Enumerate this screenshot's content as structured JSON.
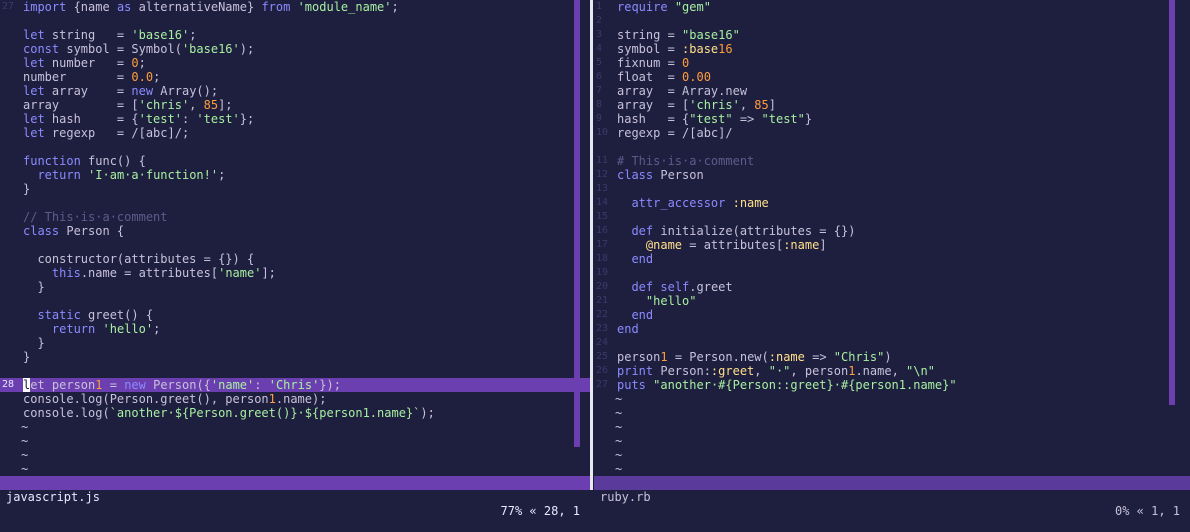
{
  "left": {
    "filename": "javascript.js",
    "position": "77% « 28, 1",
    "lines": [
      {
        "n": "27",
        "code": "import {name as alternativeName} from 'module_name';"
      },
      {
        "n": "",
        "code": ""
      },
      {
        "n": "",
        "code": "let string   = 'base16';"
      },
      {
        "n": "",
        "code": "const symbol = Symbol('base16');"
      },
      {
        "n": "",
        "code": "let number   = 0;"
      },
      {
        "n": "",
        "code": "number       = 0.0;"
      },
      {
        "n": "",
        "code": "let array    = new Array();"
      },
      {
        "n": "",
        "code": "array        = ['chris', 85];"
      },
      {
        "n": "",
        "code": "let hash     = {'test': 'test'};"
      },
      {
        "n": "",
        "code": "let regexp   = /[abc]/;"
      },
      {
        "n": "",
        "code": ""
      },
      {
        "n": "",
        "code": "function func() {"
      },
      {
        "n": "",
        "code": "  return 'I·am·a·function!';"
      },
      {
        "n": "",
        "code": "}"
      },
      {
        "n": "",
        "code": ""
      },
      {
        "n": "",
        "code": "// This·is·a·comment"
      },
      {
        "n": "",
        "code": "class Person {"
      },
      {
        "n": "",
        "code": ""
      },
      {
        "n": "",
        "code": "  constructor(attributes = {}) {"
      },
      {
        "n": "",
        "code": "    this.name = attributes['name'];"
      },
      {
        "n": "",
        "code": "  }"
      },
      {
        "n": "",
        "code": ""
      },
      {
        "n": "",
        "code": "  static greet() {"
      },
      {
        "n": "",
        "code": "    return 'hello';"
      },
      {
        "n": "",
        "code": "  }"
      },
      {
        "n": "",
        "code": "}"
      },
      {
        "n": "",
        "code": ""
      },
      {
        "n": "28",
        "code": "let person1 = new Person({'name': 'Chris'});"
      },
      {
        "n": "",
        "code": "console.log(Person.greet(), person1.name);"
      },
      {
        "n": "",
        "code": "console.log(`another·${Person.greet()}·${person1.name}`);"
      }
    ],
    "tildes": 4
  },
  "right": {
    "filename": "ruby.rb",
    "position": "0% « 1, 1",
    "lines": [
      {
        "n": "1",
        "code": "require \"gem\""
      },
      {
        "n": "2",
        "code": ""
      },
      {
        "n": "3",
        "code": "string = \"base16\""
      },
      {
        "n": "4",
        "code": "symbol = :base16"
      },
      {
        "n": "5",
        "code": "fixnum = 0"
      },
      {
        "n": "6",
        "code": "float  = 0.00"
      },
      {
        "n": "7",
        "code": "array  = Array.new"
      },
      {
        "n": "8",
        "code": "array  = ['chris', 85]"
      },
      {
        "n": "9",
        "code": "hash   = {\"test\" => \"test\"}"
      },
      {
        "n": "10",
        "code": "regexp = /[abc]/"
      },
      {
        "n": "",
        "code": ""
      },
      {
        "n": "11",
        "code": "# This·is·a·comment"
      },
      {
        "n": "12",
        "code": "class Person"
      },
      {
        "n": "13",
        "code": ""
      },
      {
        "n": "14",
        "code": "  attr_accessor :name"
      },
      {
        "n": "15",
        "code": ""
      },
      {
        "n": "16",
        "code": "  def initialize(attributes = {})"
      },
      {
        "n": "17",
        "code": "    @name = attributes[:name]"
      },
      {
        "n": "18",
        "code": "  end"
      },
      {
        "n": "19",
        "code": ""
      },
      {
        "n": "20",
        "code": "  def self.greet"
      },
      {
        "n": "21",
        "code": "    \"hello\""
      },
      {
        "n": "22",
        "code": "  end"
      },
      {
        "n": "23",
        "code": "end"
      },
      {
        "n": "24",
        "code": ""
      },
      {
        "n": "25",
        "code": "person1 = Person.new(:name => \"Chris\")"
      },
      {
        "n": "26",
        "code": "print Person::greet, \"·\", person1.name, \"\\n\""
      },
      {
        "n": "27",
        "code": "puts \"another·#{Person::greet}·#{person1.name}\""
      }
    ],
    "tildes": 6
  },
  "colors": {
    "background": "#1e1e3f",
    "statusline": "#6c3fb0",
    "keyword": "#8b8bff",
    "string": "#a7f0a0",
    "number": "#ff9d3c",
    "comment": "#5c5c8c"
  }
}
